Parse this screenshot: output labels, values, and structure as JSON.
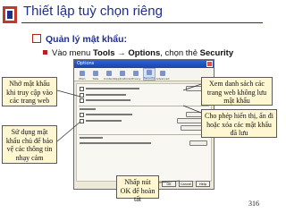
{
  "slide": {
    "title": "Thiết lập tuỳ chọn riêng",
    "bullet1": "Quản lý mật khẩu:",
    "bullet2_prefix": "Vào menu ",
    "bullet2_tools": "Tools",
    "bullet2_arrow": "→",
    "bullet2_options": "Options",
    "bullet2_mid": ", chọn thẻ ",
    "bullet2_security": "Security",
    "page_number": "316"
  },
  "callouts": {
    "left_top": "Nhớ mật khẩu khi truy cập vào các trang web",
    "right_top": "Xem danh sách các trang web không lưu mật khẩu",
    "right_mid": "Cho phép hiển thị, ẩn đi hoặc xóa các mật khẩu đã lưu",
    "left_bottom": "Sử dụng mật khẩu chủ để bảo vệ các thông tin nhạy cảm",
    "bottom": "Nhấp nút OK để hoàn tất"
  },
  "dialog": {
    "title": "Options",
    "tabs": [
      "Main",
      "Tabs",
      "Content",
      "Applications",
      "Privacy",
      "Security",
      "Advanced"
    ],
    "active_tab": "Security",
    "sections": [
      "Passwords",
      "Warning Messages"
    ],
    "passwords_options": [
      "Remember passwords for sites",
      "Use a master password"
    ],
    "exceptions_button": "Exceptions...",
    "change_master_button": "Change Master Password...",
    "saved_passwords_button": "Saved Passwords...",
    "settings_button": "Settings...",
    "footer_buttons": [
      "OK",
      "Cancel",
      "Help"
    ]
  },
  "colors": {
    "title": "#1f2f8a",
    "bullet_marker": "#b22222",
    "callout_bg": "#fff7d2",
    "dialog_bg": "#ece9d8",
    "dialog_titlebar": "#1a44a8"
  }
}
